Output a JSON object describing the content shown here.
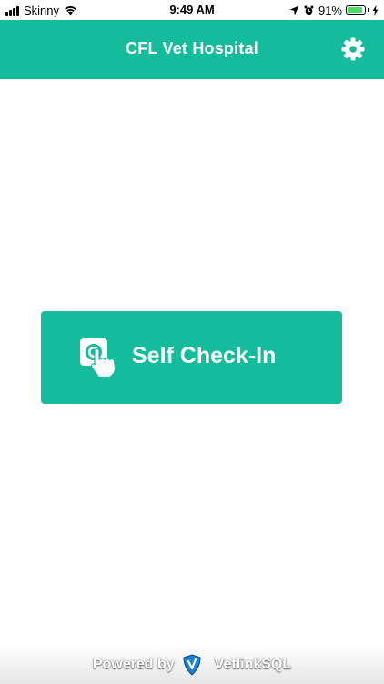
{
  "status_bar": {
    "carrier": "Skinny",
    "time": "9:49 AM",
    "battery_percent": "91%",
    "battery_level": 0.91,
    "icons": [
      "signal-icon",
      "wifi-icon",
      "location-icon",
      "alarm-icon",
      "battery-icon",
      "charging-icon"
    ]
  },
  "header": {
    "title": "CFL Vet Hospital",
    "settings_icon": "gear-icon"
  },
  "main": {
    "checkin_label": "Self Check-In",
    "checkin_icon": "touch-icon"
  },
  "footer": {
    "powered_by": "Powered by",
    "brand": "VetlinkSQL",
    "brand_icon": "shield-icon"
  },
  "colors": {
    "accent": "#15bc9c",
    "background": "#ffffff",
    "text_on_accent": "#ffffff",
    "battery_green": "#4cd964",
    "shield_blue": "#1f7fd1"
  }
}
